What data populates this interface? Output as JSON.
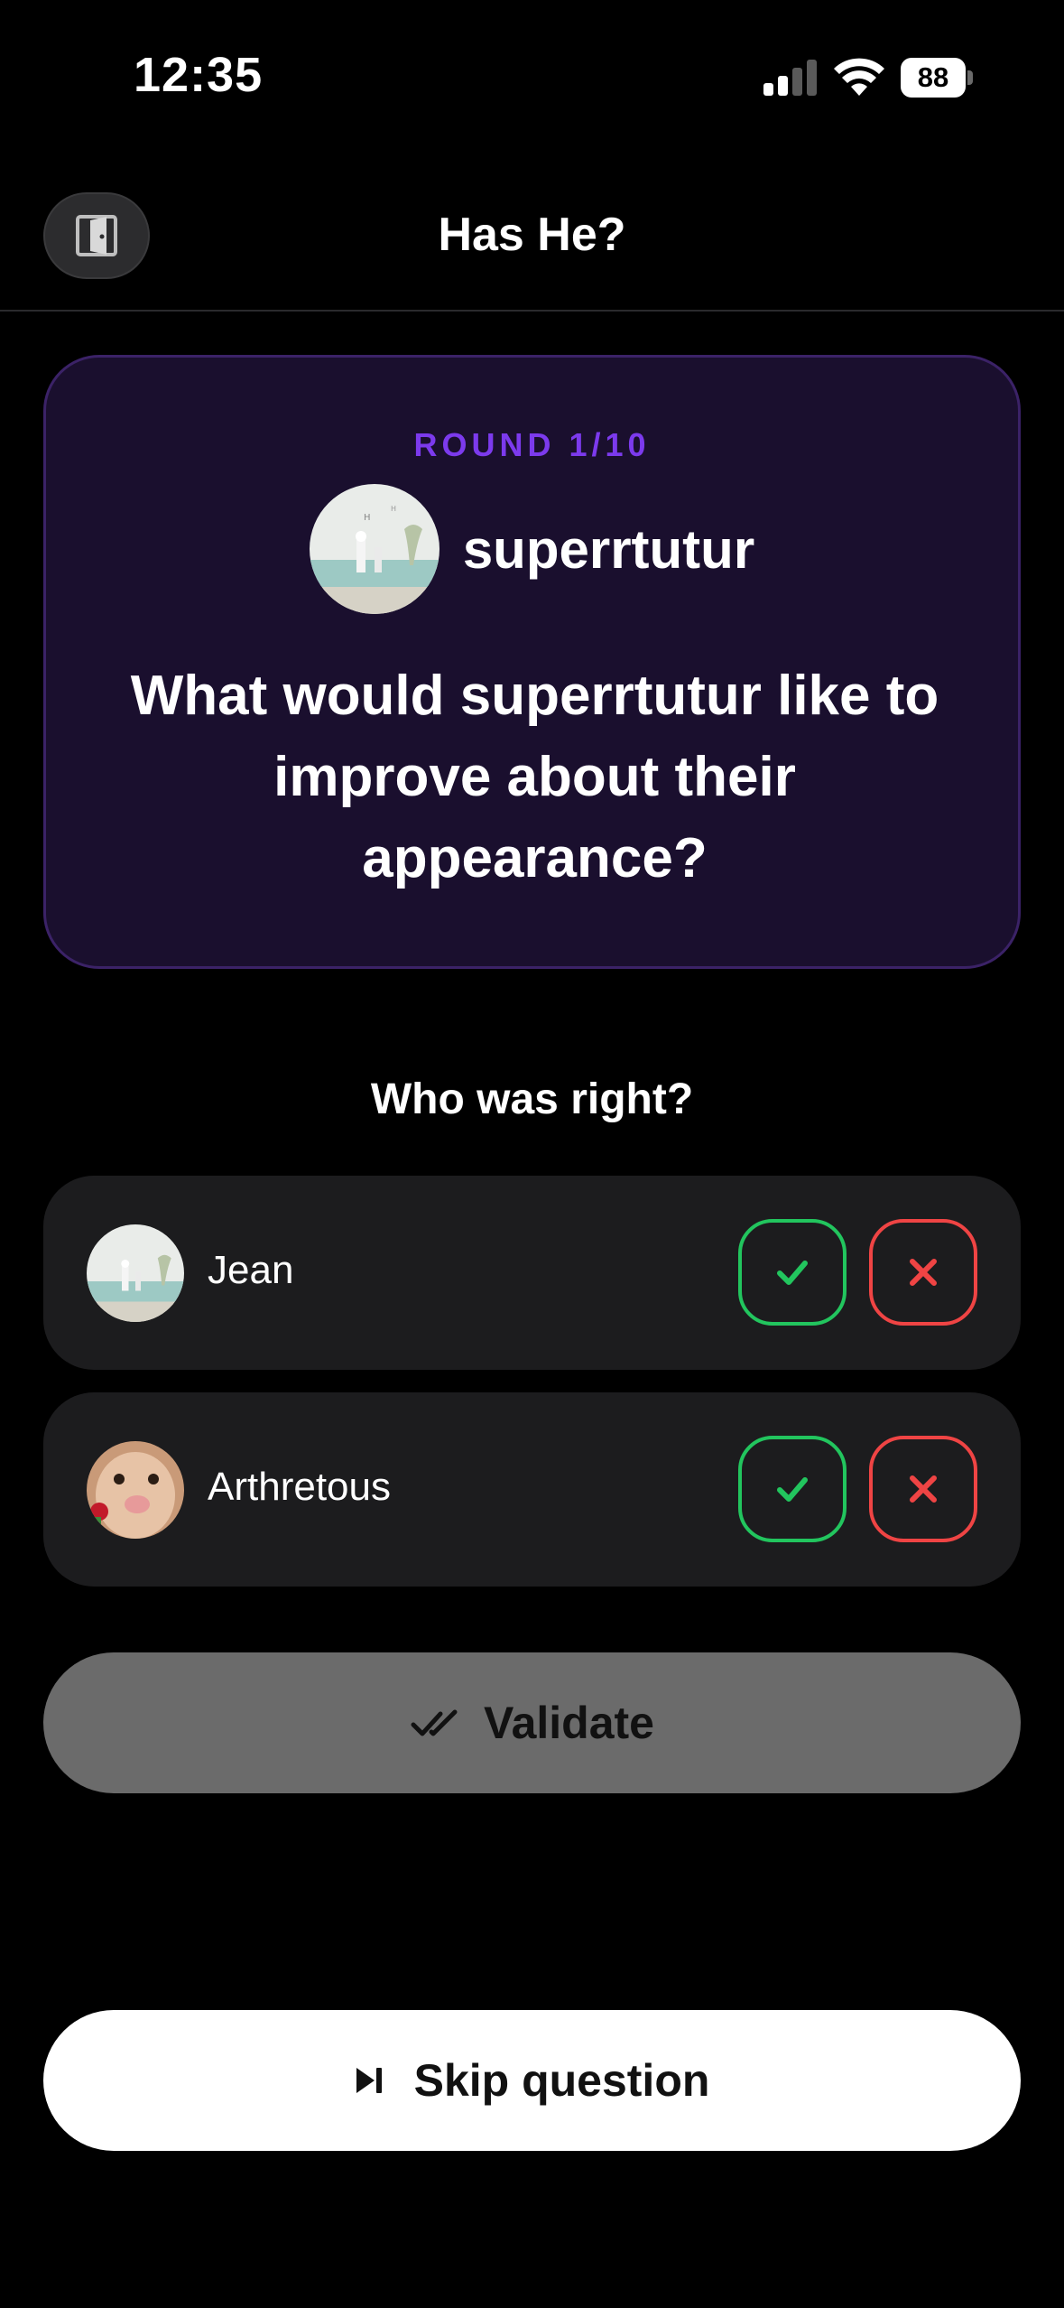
{
  "status_bar": {
    "time": "12:35",
    "battery": "88"
  },
  "header": {
    "title": "Has He?",
    "exit_icon": "door-exit-icon"
  },
  "round_card": {
    "round_label": "ROUND 1/10",
    "player_name": "superrtutur",
    "question": "What would superrtutur like to improve about their appearance?"
  },
  "who_right": {
    "label": "Who was right?",
    "players": [
      {
        "name": "Jean"
      },
      {
        "name": "Arthretous"
      }
    ]
  },
  "actions": {
    "validate_label": "Validate",
    "skip_label": "Skip question"
  },
  "colors": {
    "accent_purple": "#7c3aed",
    "correct_green": "#22c55e",
    "wrong_red": "#ef4444",
    "card_bg": "#1a0f2e"
  }
}
